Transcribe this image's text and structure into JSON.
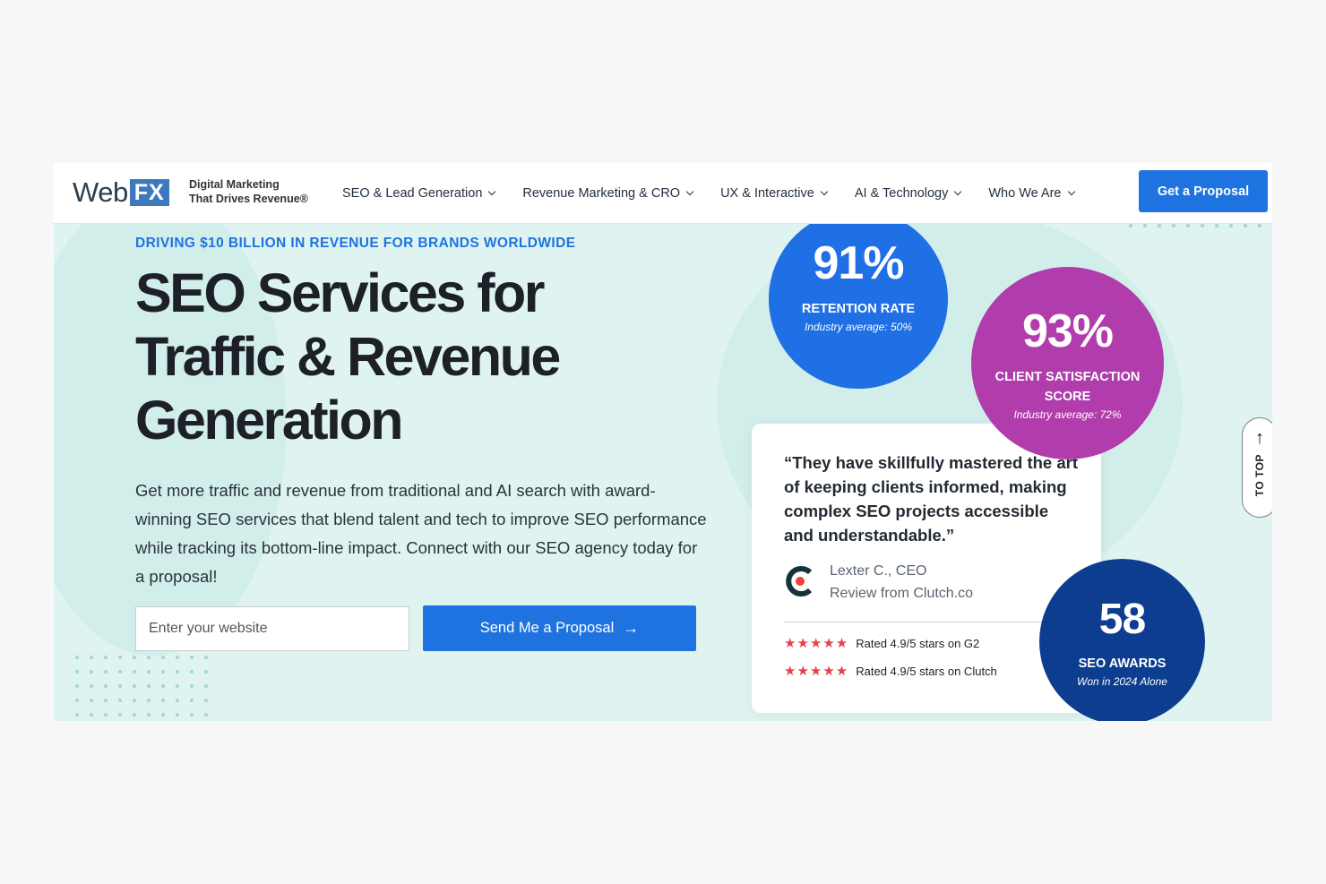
{
  "header": {
    "logo_web": "Web",
    "logo_fx": "FX",
    "tagline_line1": "Digital Marketing",
    "tagline_line2": "That Drives Revenue®",
    "nav": [
      {
        "label": "SEO & Lead Generation"
      },
      {
        "label": "Revenue Marketing & CRO"
      },
      {
        "label": "UX & Interactive"
      },
      {
        "label": "AI & Technology"
      },
      {
        "label": "Who We Are"
      }
    ],
    "cta_label": "Get a Proposal"
  },
  "hero": {
    "eyebrow": "DRIVING $10 BILLION IN REVENUE FOR BRANDS WORLDWIDE",
    "headline_line1": "SEO Services for",
    "headline_line2": "Traffic & Revenue",
    "headline_line3": "Generation",
    "description": "Get more traffic and revenue from traditional and AI search with award-winning SEO services that blend talent and tech to improve SEO performance while tracking its bottom-line impact. Connect with our SEO agency today for a proposal!",
    "input_placeholder": "Enter your website",
    "input_value": "",
    "send_label": "Send Me a Proposal",
    "send_arrow": "→"
  },
  "stats": [
    {
      "number": "91%",
      "label": "RETENTION RATE",
      "sub": "Industry average: 50%",
      "color": "#1f6fe5"
    },
    {
      "number": "93%",
      "label": "CLIENT SATISFACTION SCORE",
      "sub": "Industry average: 72%",
      "color": "#b03dab"
    },
    {
      "number": "58",
      "label": "SEO AWARDS",
      "sub": "Won in 2024 Alone",
      "color": "#0d3d8f"
    }
  ],
  "review": {
    "quote": "“They have skillfully mastered the art of keeping clients informed, making complex SEO projects accessible and understandable.”",
    "reviewer_name": "Lexter C., CEO",
    "reviewer_source": "Review from Clutch.co",
    "ratings": [
      {
        "stars": "★★★★★",
        "text": "Rated 4.9/5 stars on G2"
      },
      {
        "stars": "★★★★★",
        "text": "Rated 4.9/5 stars on Clutch"
      }
    ]
  },
  "to_top": {
    "arrow": "↑",
    "label": "TO TOP"
  },
  "colors": {
    "accent": "#1f73e0",
    "background": "#dff4f1",
    "star": "#e8404a"
  }
}
